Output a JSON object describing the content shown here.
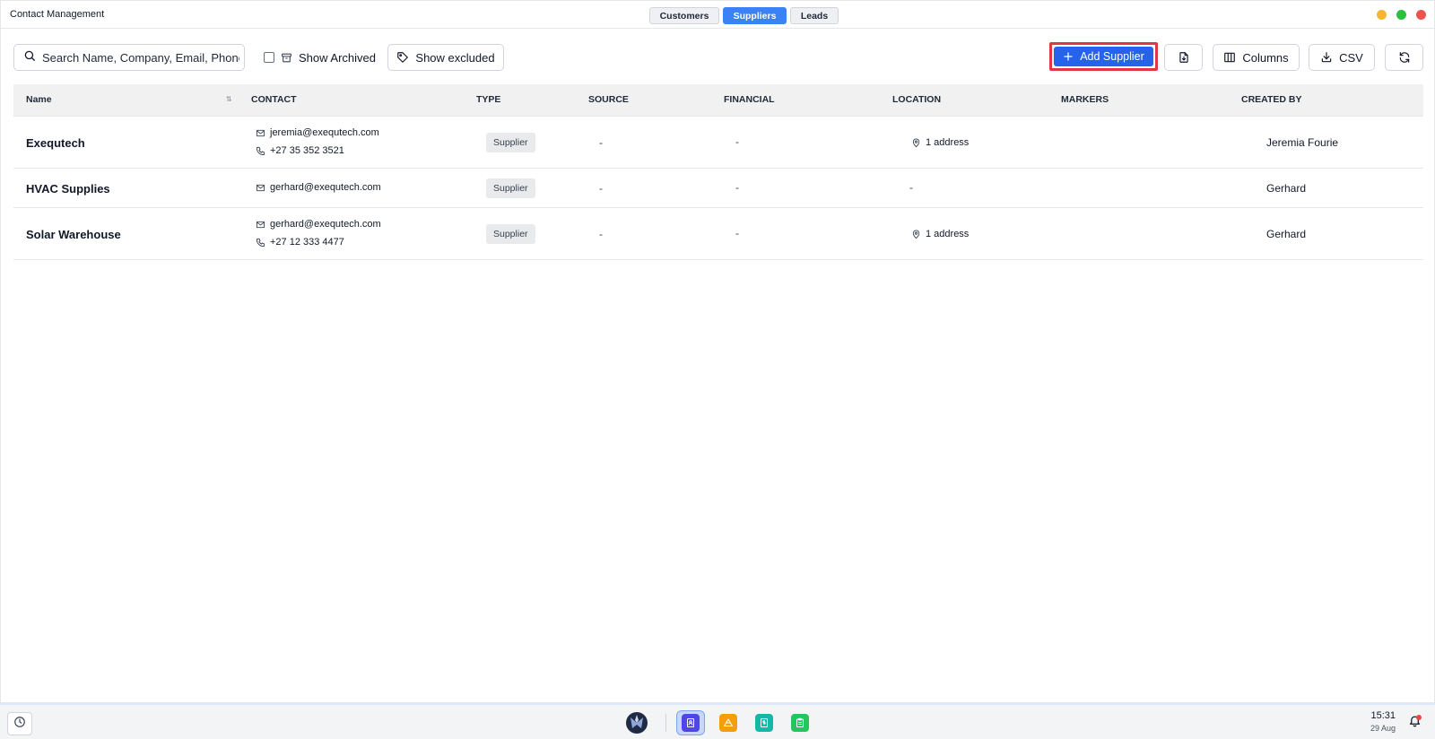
{
  "window": {
    "title": "Contact Management",
    "tabs": [
      {
        "label": "Customers",
        "active": false
      },
      {
        "label": "Suppliers",
        "active": true
      },
      {
        "label": "Leads",
        "active": false
      }
    ]
  },
  "toolbar": {
    "search_placeholder": "Search Name, Company, Email, Phone,...",
    "show_archived_label": "Show Archived",
    "show_archived_checked": false,
    "show_excluded_label": "Show excluded",
    "add_supplier_label": "Add Supplier",
    "columns_label": "Columns",
    "csv_label": "CSV"
  },
  "table": {
    "headers": {
      "name": "Name",
      "contact": "CONTACT",
      "type": "TYPE",
      "source": "SOURCE",
      "financial": "FINANCIAL",
      "location": "LOCATION",
      "markers": "MARKERS",
      "created_by": "CREATED BY"
    },
    "rows": [
      {
        "name": "Exequtech",
        "email": "jeremia@exequtech.com",
        "phone": "+27 35 352 3521",
        "type": "Supplier",
        "source": "-",
        "financial": "-",
        "location": "1 address",
        "created_by": "Jeremia Fourie"
      },
      {
        "name": "HVAC Supplies",
        "email": "gerhard@exequtech.com",
        "type": "Supplier",
        "source": "-",
        "financial": "-",
        "location": "-",
        "created_by": "Gerhard"
      },
      {
        "name": "Solar Warehouse",
        "email": "gerhard@exequtech.com",
        "phone": "+27 12 333 4477",
        "type": "Supplier",
        "source": "-",
        "financial": "-",
        "location": "1 address",
        "created_by": "Gerhard"
      }
    ]
  },
  "taskbar": {
    "time": "15:31",
    "date": "29 Aug",
    "apps": [
      "contacts-app-icon",
      "projects-app-icon",
      "finance-app-icon",
      "tasks-app-icon"
    ]
  },
  "colors": {
    "accent": "#3b82f6",
    "primary_button": "#2563eb",
    "highlight_border": "#e23645"
  }
}
